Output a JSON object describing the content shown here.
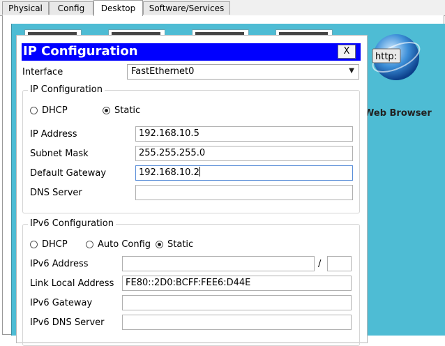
{
  "tabs": [
    {
      "label": "Physical"
    },
    {
      "label": "Config"
    },
    {
      "label": "Desktop",
      "active": true
    },
    {
      "label": "Software/Services"
    }
  ],
  "desktop": {
    "web_browser_label": "Web Browser",
    "web_icon_text": "http:"
  },
  "dialog": {
    "title": "IP Configuration",
    "close_label": "X",
    "interface_label": "Interface",
    "interface_value": "FastEthernet0",
    "ipv4": {
      "legend": "IP Configuration",
      "dhcp_label": "DHCP",
      "static_label": "Static",
      "mode": "Static",
      "ip_address_label": "IP Address",
      "ip_address": "192.168.10.5",
      "subnet_mask_label": "Subnet Mask",
      "subnet_mask": "255.255.255.0",
      "default_gateway_label": "Default Gateway",
      "default_gateway": "192.168.10.2",
      "dns_server_label": "DNS Server",
      "dns_server": ""
    },
    "ipv6": {
      "legend": "IPv6 Configuration",
      "dhcp_label": "DHCP",
      "auto_config_label": "Auto Config",
      "static_label": "Static",
      "mode": "Static",
      "ipv6_address_label": "IPv6 Address",
      "ipv6_address": "",
      "prefix_separator": "/",
      "prefix_length": "",
      "link_local_label": "Link Local Address",
      "link_local_address": "FE80::2D0:BCFF:FEE6:D44E",
      "ipv6_gateway_label": "IPv6 Gateway",
      "ipv6_gateway": "",
      "ipv6_dns_label": "IPv6 DNS Server",
      "ipv6_dns": ""
    }
  },
  "colors": {
    "titlebar": "#0000ff",
    "desktop_background": "#4ebcd4"
  }
}
